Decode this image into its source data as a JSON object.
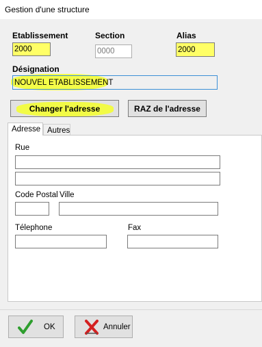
{
  "window": {
    "title": "Gestion d'une structure"
  },
  "header": {
    "etablissement_label": "Etablissement",
    "etablissement_value": "2000",
    "section_label": "Section",
    "section_value": "0000",
    "alias_label": "Alias",
    "alias_value": "2000",
    "designation_label": "Désignation",
    "designation_value": "NOUVEL ETABLISSEMENT"
  },
  "actions": {
    "change_address": "Changer l'adresse",
    "reset_address": "RAZ de l'adresse"
  },
  "tabs": [
    {
      "label": "Adresse",
      "active": true
    },
    {
      "label": "Autres",
      "active": false
    }
  ],
  "address": {
    "rue_label": "Rue",
    "rue1_value": "",
    "rue2_value": "",
    "cp_label": "Code Postal",
    "cp_value": "",
    "ville_label": "Ville",
    "ville_value": "",
    "tel_label": "Télephone",
    "tel_value": "",
    "fax_label": "Fax",
    "fax_value": ""
  },
  "footer": {
    "ok_label": "OK",
    "cancel_label": "Annuler"
  },
  "colors": {
    "highlight": "#f5ff2a",
    "ok_green": "#2e9e2e",
    "cancel_red": "#d42020"
  },
  "icons": {
    "ok": "checkmark-icon",
    "cancel": "red-x-icon"
  }
}
